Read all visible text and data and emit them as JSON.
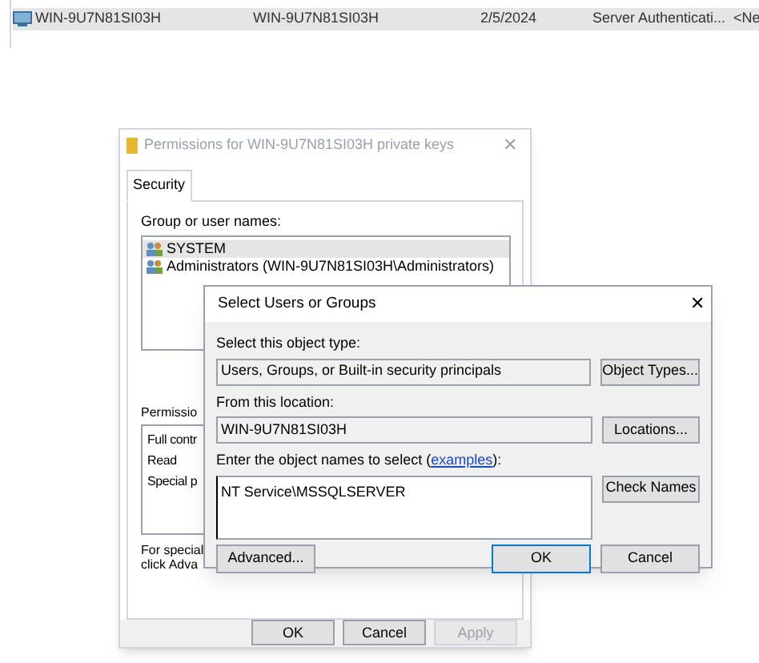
{
  "background_list": {
    "rows": [
      {
        "selected": true,
        "cells": [
          "WIN-9U7N81SI03H",
          "WIN-9U7N81SI03H",
          "2/5/2024",
          "Server Authenticati...",
          "<Ne"
        ]
      }
    ]
  },
  "permissions_dialog": {
    "title": "Permissions for WIN-9U7N81SI03H private keys",
    "tabs": [
      {
        "label": "Security",
        "selected": true
      }
    ],
    "group_label": "Group or user names:",
    "principals": [
      {
        "name": "SYSTEM",
        "selected": true
      },
      {
        "name": "Administrators (WIN-9U7N81SI03H\\Administrators)",
        "selected": false
      }
    ],
    "permissions_label": "Permissio",
    "permissions": [
      "Full contr",
      "Read",
      "Special p"
    ],
    "special_note": [
      "For special",
      "click Adva"
    ],
    "buttons": [
      {
        "label": "OK",
        "disabled": false
      },
      {
        "label": "Cancel",
        "disabled": false
      },
      {
        "label": "Apply",
        "disabled": true
      }
    ]
  },
  "select_dialog": {
    "title": "Select Users or Groups",
    "close": "✕",
    "object_type_label": "Select this object type:",
    "object_type": "Users, Groups, or Built-in security principals",
    "object_types_button": "Object Types...",
    "location_label": "From this location:",
    "location": "WIN-9U7N81SI03H",
    "locations_button": "Locations...",
    "names_label": "Enter the object names to select (",
    "names_link": "examples",
    "names_label_end": "):",
    "names_value": "NT Service\\MSSQLSERVER",
    "check_names_button": "Check Names",
    "buttons": [
      {
        "label": "Advanced...",
        "default": false
      },
      {
        "label": "OK",
        "default": true
      },
      {
        "label": "Cancel",
        "default": false
      }
    ]
  }
}
